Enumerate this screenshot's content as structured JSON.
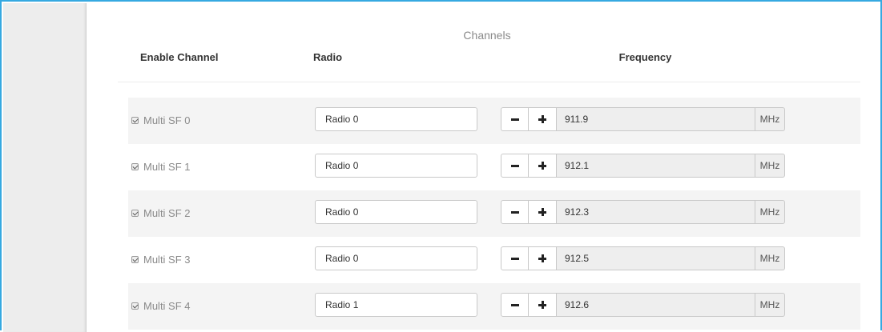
{
  "section": {
    "title": "Channels"
  },
  "columns": {
    "enable": "Enable Channel",
    "radio": "Radio",
    "frequency": "Frequency"
  },
  "channels": [
    {
      "label": "Multi SF 0",
      "enabled": true,
      "radio": "Radio 0",
      "frequency": "911.9",
      "unit": "MHz"
    },
    {
      "label": "Multi SF 1",
      "enabled": true,
      "radio": "Radio 0",
      "frequency": "912.1",
      "unit": "MHz"
    },
    {
      "label": "Multi SF 2",
      "enabled": true,
      "radio": "Radio 0",
      "frequency": "912.3",
      "unit": "MHz"
    },
    {
      "label": "Multi SF 3",
      "enabled": true,
      "radio": "Radio 0",
      "frequency": "912.5",
      "unit": "MHz"
    },
    {
      "label": "Multi SF 4",
      "enabled": true,
      "radio": "Radio 1",
      "frequency": "912.6",
      "unit": "MHz"
    }
  ],
  "colors": {
    "accent_border": "#36a9e1",
    "row_stripe": "#f4f4f4",
    "sidebar": "#ededed"
  },
  "icons": {
    "decrement": "minus-icon",
    "increment": "plus-icon",
    "enabled": "checkbox-checked-icon"
  }
}
